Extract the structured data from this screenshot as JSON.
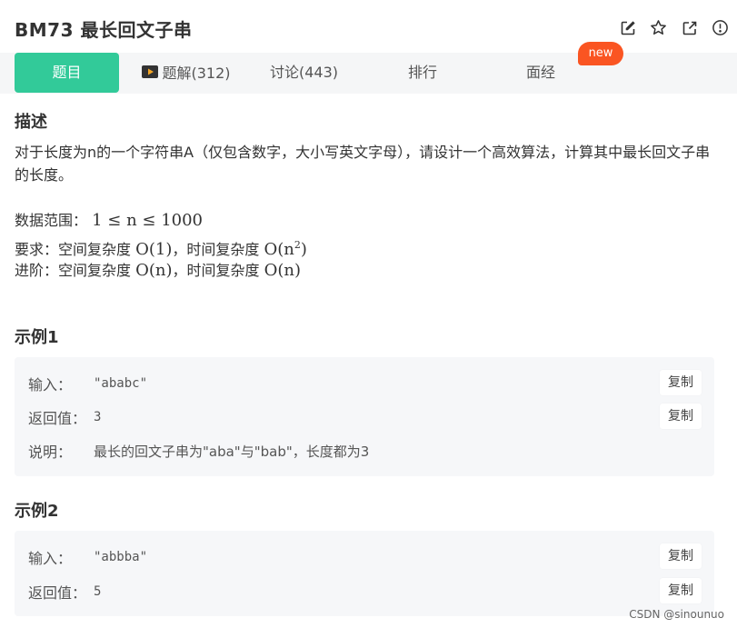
{
  "header": {
    "title": "BM73  最长回文子串",
    "icons": [
      "edit-icon",
      "star-icon",
      "share-icon",
      "info-icon"
    ]
  },
  "tabs": {
    "problem": "题目",
    "solution": "题解(312)",
    "discuss": "讨论(443)",
    "rank": "排行",
    "interview": "面经",
    "new_badge": "new"
  },
  "description": {
    "heading": "描述",
    "text": "对于长度为n的一个字符串A（仅包含数字，大小写英文字母），请设计一个高效算法，计算其中最长回文子串的长度。",
    "range_label": "数据范围：",
    "range_math": "1 ≤ n ≤ 1000",
    "req_label": "要求：空间复杂度",
    "req_space": "O(1)",
    "req_mid": "，时间复杂度",
    "req_time_base": "O(n",
    "req_time_exp": "2",
    "req_time_end": ")",
    "adv_label": "进阶：空间复杂度",
    "adv_space": "O(n)",
    "adv_mid": "，时间复杂度",
    "adv_time": "O(n)"
  },
  "example1": {
    "heading": "示例1",
    "input_label": "输入：",
    "input_value": "\"ababc\"",
    "output_label": "返回值：",
    "output_value": "3",
    "explain_label": "说明：",
    "explain_value": "最长的回文子串为\"aba\"与\"bab\"，长度都为3",
    "copy_label": "复制"
  },
  "example2": {
    "heading": "示例2",
    "input_label": "输入：",
    "input_value": "\"abbba\"",
    "output_label": "返回值：",
    "output_value": "5",
    "copy_label": "复制"
  },
  "watermark": "CSDN @sinounuo",
  "colors": {
    "accent": "#32ca99",
    "badge": "#fa5522",
    "tabbar_bg": "#f5f6f7",
    "example_bg": "#f6f7f9"
  }
}
